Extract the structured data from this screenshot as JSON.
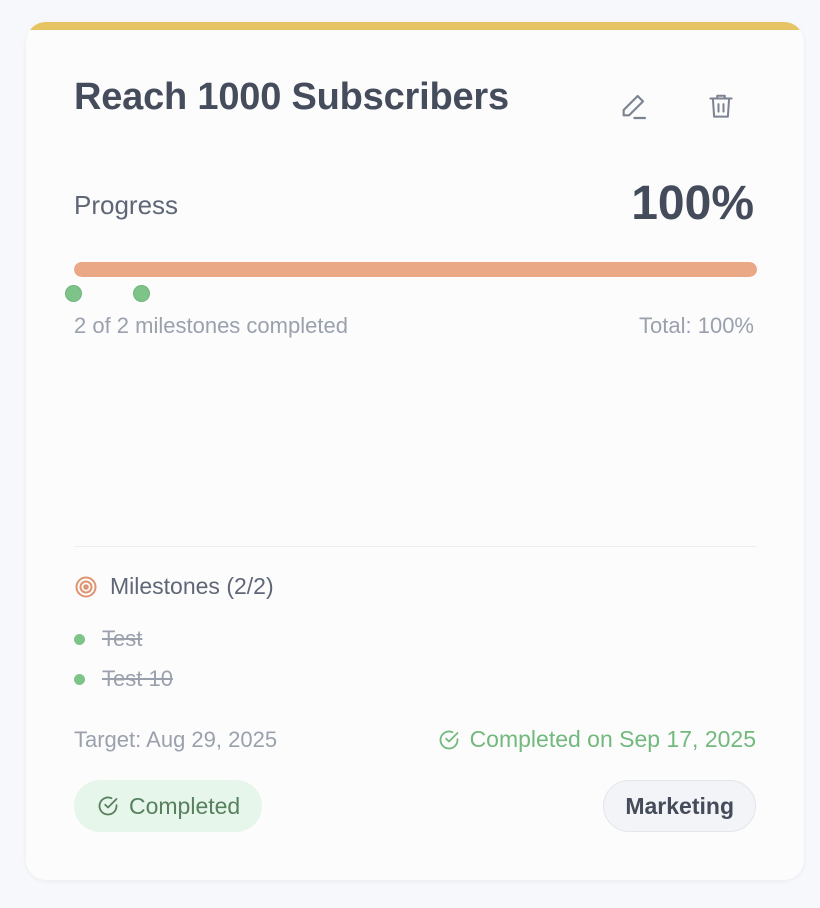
{
  "goal": {
    "title": "Reach 1000 Subscribers",
    "accent_color": "#e6c464",
    "actions": {
      "edit_icon": "pencil-icon",
      "delete_icon": "trash-icon"
    }
  },
  "progress": {
    "label": "Progress",
    "value_text": "100%",
    "fraction": 1.0,
    "bar_color": "#eba886",
    "milestone_markers": 2,
    "summary": "2 of 2 milestones completed",
    "total": "Total: 100%"
  },
  "milestones": {
    "header": "Milestones (2/2)",
    "icon": "target-icon",
    "items": [
      {
        "label": "Test",
        "done": true
      },
      {
        "label": "Test 10",
        "done": true
      }
    ]
  },
  "dates": {
    "target": "Target: Aug 29, 2025",
    "completed_on": "Completed on Sep 17, 2025",
    "completed_icon": "check-circle-icon"
  },
  "status": {
    "label": "Completed",
    "icon": "check-circle-icon",
    "color": "#72b97d"
  },
  "category": {
    "label": "Marketing"
  }
}
